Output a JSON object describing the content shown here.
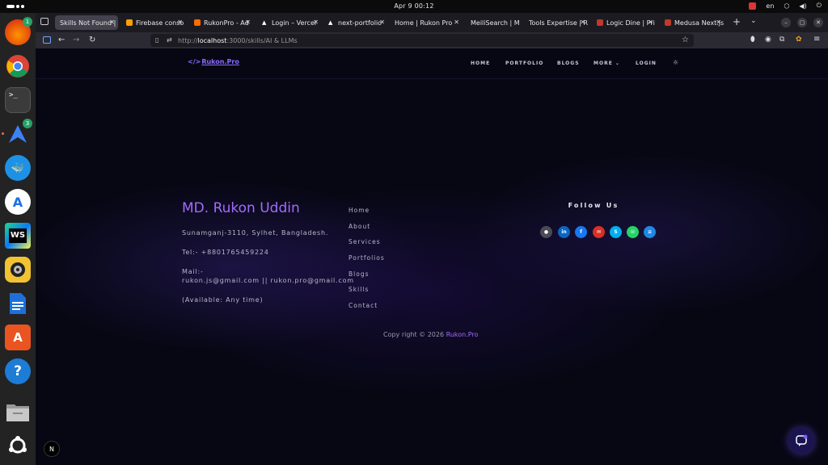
{
  "topbar": {
    "clock": "Apr 9  00:12",
    "language": "en"
  },
  "dock": {
    "items": [
      {
        "name": "firefox",
        "badge": "1"
      },
      {
        "name": "chrome"
      },
      {
        "name": "terminal"
      },
      {
        "name": "arch-tool",
        "badge": "3"
      },
      {
        "name": "docker"
      },
      {
        "name": "app-store"
      },
      {
        "name": "webstorm",
        "label": "WS"
      },
      {
        "name": "rhythmbox"
      },
      {
        "name": "libreoffice-writer"
      },
      {
        "name": "software-center"
      },
      {
        "name": "help"
      },
      {
        "name": "files"
      },
      {
        "name": "ubuntu"
      }
    ]
  },
  "browser": {
    "tabs": [
      {
        "label": "Skills Not Found |",
        "active": true
      },
      {
        "label": "Firebase conso"
      },
      {
        "label": "RukonPro - Ad"
      },
      {
        "label": "Login – Vercel"
      },
      {
        "label": "next-portfolio"
      },
      {
        "label": "Home | Rukon Pro"
      },
      {
        "label": "MeiliSearch | M"
      },
      {
        "label": "Tools Expertise | R"
      },
      {
        "label": "Logic Dine | Pri"
      },
      {
        "label": "Medusa Next.js"
      }
    ],
    "new_tab": "+",
    "url_prefix": "http://",
    "url_host": "localhost",
    "url_rest": ":3000/skills/AI & LLMs"
  },
  "site": {
    "logo": "Rukon.Pro",
    "logo_bracket": "</>",
    "nav": [
      "HOME",
      "PORTFOLIO",
      "BLOGS",
      "MORE",
      "LOGIN"
    ],
    "more_caret": "⌄",
    "theme_icon": "☼"
  },
  "footer": {
    "name": "MD. Rukon Uddin",
    "address": "Sunamganj-3110, Sylhet, Bangladesh.",
    "tel": "Tel:- +8801765459224",
    "mail_label": "Mail:-",
    "mail": "rukon.js@gmail.com || rukon.pro@gmail.com",
    "availability": "(Available: Any time)",
    "links": [
      "Home",
      "About",
      "Services",
      "Portfolios",
      "Blogs",
      "Skills",
      "Contact"
    ],
    "follow_title": "Follow Us",
    "social": [
      {
        "name": "github",
        "glyph": "●",
        "color": "#4b4b55"
      },
      {
        "name": "linkedin",
        "glyph": "in",
        "color": "#0a66c2"
      },
      {
        "name": "facebook",
        "glyph": "f",
        "color": "#1877f2"
      },
      {
        "name": "gmail",
        "glyph": "✉",
        "color": "#d93025"
      },
      {
        "name": "skype",
        "glyph": "S",
        "color": "#00aff0"
      },
      {
        "name": "whatsapp",
        "glyph": "☏",
        "color": "#25d366"
      },
      {
        "name": "stackoverflow",
        "glyph": "≡",
        "color": "#1e88e5"
      }
    ],
    "copyright": "Copy right © 2026",
    "copyright_brand": "Rukon.Pro"
  },
  "overlay": {
    "next_badge": "N"
  }
}
